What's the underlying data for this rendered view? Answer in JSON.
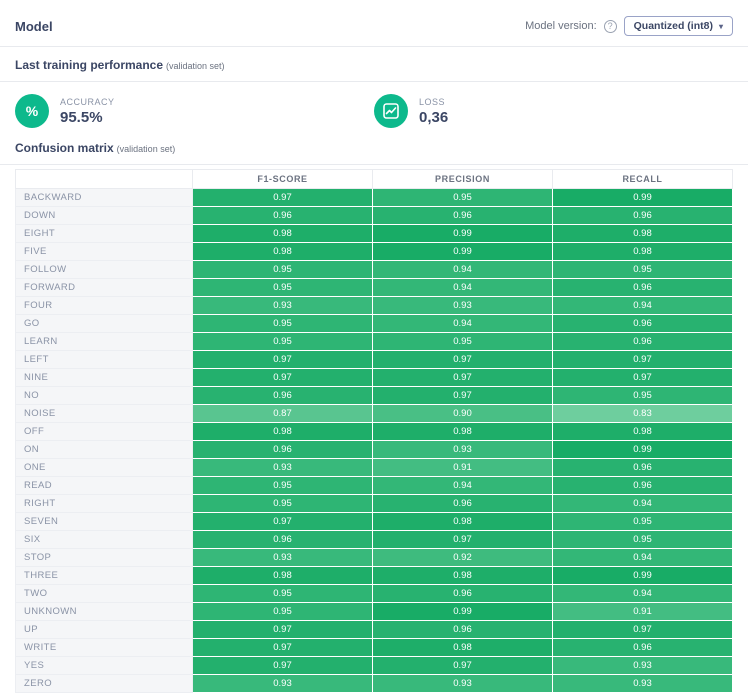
{
  "header": {
    "title": "Model",
    "model_version_label": "Model version:",
    "help_glyph": "?",
    "version_button_label": "Quantized (int8)",
    "version_caret": "▾"
  },
  "performance": {
    "section_title": "Last training performance",
    "section_suffix": "(validation set)",
    "metrics": [
      {
        "icon": "percent-icon",
        "glyph": "%",
        "label": "ACCURACY",
        "value": "95.5%"
      },
      {
        "icon": "loss-chart-icon",
        "label": "LOSS",
        "value": "0,36"
      }
    ]
  },
  "confusion": {
    "section_title": "Confusion matrix",
    "section_suffix": "(validation set)",
    "columns": [
      "F1-SCORE",
      "PRECISION",
      "RECALL"
    ],
    "rows": [
      {
        "label": "BACKWARD",
        "values": [
          0.97,
          0.95,
          0.99
        ]
      },
      {
        "label": "DOWN",
        "values": [
          0.96,
          0.96,
          0.96
        ]
      },
      {
        "label": "EIGHT",
        "values": [
          0.98,
          0.99,
          0.98
        ]
      },
      {
        "label": "FIVE",
        "values": [
          0.98,
          0.99,
          0.98
        ]
      },
      {
        "label": "FOLLOW",
        "values": [
          0.95,
          0.94,
          0.95
        ]
      },
      {
        "label": "FORWARD",
        "values": [
          0.95,
          0.94,
          0.96
        ]
      },
      {
        "label": "FOUR",
        "values": [
          0.93,
          0.93,
          0.94
        ]
      },
      {
        "label": "GO",
        "values": [
          0.95,
          0.94,
          0.96
        ]
      },
      {
        "label": "LEARN",
        "values": [
          0.95,
          0.95,
          0.96
        ]
      },
      {
        "label": "LEFT",
        "values": [
          0.97,
          0.97,
          0.97
        ]
      },
      {
        "label": "NINE",
        "values": [
          0.97,
          0.97,
          0.97
        ]
      },
      {
        "label": "NO",
        "values": [
          0.96,
          0.97,
          0.95
        ]
      },
      {
        "label": "NOISE",
        "values": [
          0.87,
          0.9,
          0.83
        ]
      },
      {
        "label": "OFF",
        "values": [
          0.98,
          0.98,
          0.98
        ]
      },
      {
        "label": "ON",
        "values": [
          0.96,
          0.93,
          0.99
        ]
      },
      {
        "label": "ONE",
        "values": [
          0.93,
          0.91,
          0.96
        ]
      },
      {
        "label": "READ",
        "values": [
          0.95,
          0.94,
          0.96
        ]
      },
      {
        "label": "RIGHT",
        "values": [
          0.95,
          0.96,
          0.94
        ]
      },
      {
        "label": "SEVEN",
        "values": [
          0.97,
          0.98,
          0.95
        ]
      },
      {
        "label": "SIX",
        "values": [
          0.96,
          0.97,
          0.95
        ]
      },
      {
        "label": "STOP",
        "values": [
          0.93,
          0.92,
          0.94
        ]
      },
      {
        "label": "THREE",
        "values": [
          0.98,
          0.98,
          0.99
        ]
      },
      {
        "label": "TWO",
        "values": [
          0.95,
          0.96,
          0.94
        ]
      },
      {
        "label": "UNKNOWN",
        "values": [
          0.95,
          0.99,
          0.91
        ]
      },
      {
        "label": "UP",
        "values": [
          0.97,
          0.96,
          0.97
        ]
      },
      {
        "label": "WRITE",
        "values": [
          0.97,
          0.98,
          0.96
        ]
      },
      {
        "label": "YES",
        "values": [
          0.97,
          0.97,
          0.93
        ]
      },
      {
        "label": "ZERO",
        "values": [
          0.93,
          0.93,
          0.93
        ]
      }
    ]
  },
  "colors": {
    "accent_green": "#0db98c",
    "cell_low": "#7ed4a8",
    "cell_high": "#13aa62",
    "row_label_bg": "#f5f6f8",
    "divider": "#e8eaee"
  }
}
